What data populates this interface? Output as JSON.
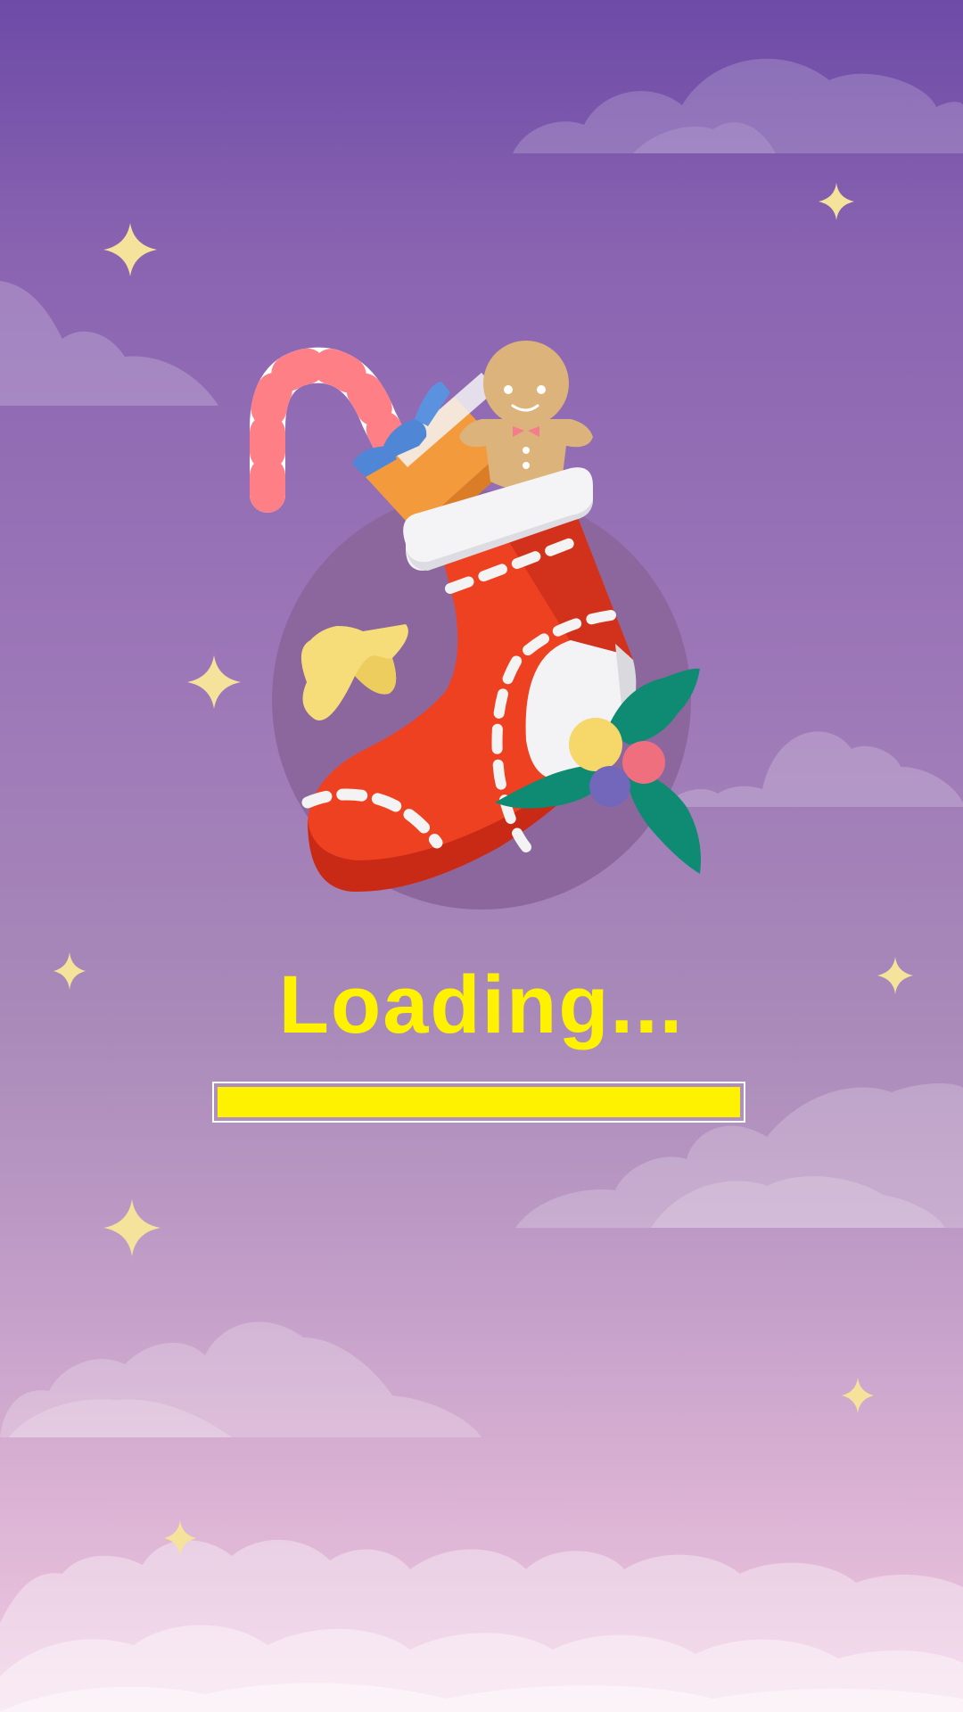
{
  "screen": {
    "loading_text": "Loading...",
    "progress": 1.0
  },
  "colors": {
    "accent_yellow": "#fff200",
    "sky_top": "#6d4ba7",
    "sky_bottom": "#f0cbe3",
    "stocking_red": "#ee4122",
    "holly_green": "#0f8a73"
  },
  "icons": [
    "sparkle-star-icon",
    "christmas-stocking-icon",
    "candy-cane-icon",
    "gift-box-icon",
    "gingerbread-man-icon",
    "star-ornament-icon",
    "holly-berries-icon"
  ]
}
